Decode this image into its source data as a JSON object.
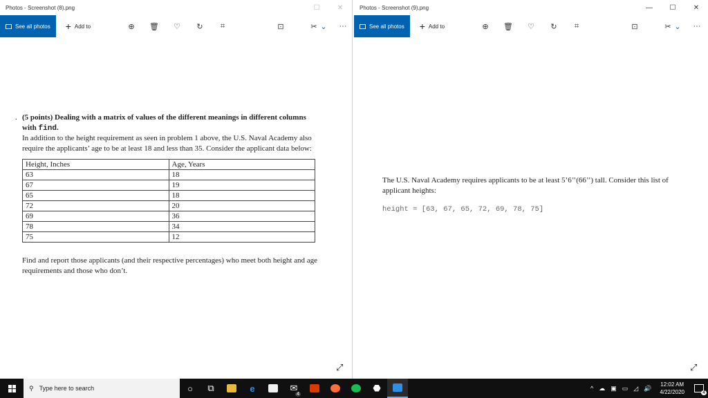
{
  "left_window": {
    "title": "Photos - Screenshot (8).png",
    "see_all": "See all photos",
    "add_to": "Add to",
    "content": {
      "bullet": ".",
      "heading_part1": "(5 points) Dealing with a matrix of values of the different meanings in different columns with ",
      "heading_code": "find",
      "heading_end": ".",
      "paragraph": "In addition to the height requirement as seen in problem 1 above, the U.S. Naval Academy also require the applicants’ age to be at least 18 and less than 35. Consider the applicant data below:",
      "table_headers": [
        "Height, Inches",
        "Age, Years"
      ],
      "table_rows": [
        [
          "63",
          "18"
        ],
        [
          "67",
          "19"
        ],
        [
          "65",
          "18"
        ],
        [
          "72",
          "20"
        ],
        [
          "69",
          "36"
        ],
        [
          "78",
          "34"
        ],
        [
          "75",
          "12"
        ]
      ],
      "find_text": "Find and report those applicants (and their respective percentages) who meet both height and age requirements and those who don’t."
    }
  },
  "right_window": {
    "title": "Photos - Screenshot (9).png",
    "see_all": "See all photos",
    "add_to": "Add to",
    "content": {
      "paragraph": "The U.S. Naval Academy requires applicants to be at least 5’6’’(66’’) tall. Consider this list of applicant heights:",
      "code": "height = [63, 67, 65, 72, 69, 78, 75]"
    }
  },
  "window_controls": {
    "minimize": "—",
    "maximize": "☐",
    "close": "✕"
  },
  "toolbar_glyphs": {
    "zoom": "⊕",
    "delete": "🗑",
    "favorite": "♡",
    "rotate": "↻",
    "crop": "⌗",
    "enhance": "⊡",
    "edit": "✂",
    "chevron": "⌄",
    "more": "···",
    "expand": "⤢"
  },
  "taskbar": {
    "search_placeholder": "Type here to search",
    "time": "12:02 AM",
    "date": "4/22/2020",
    "notification_count": "4",
    "mail_badge": "4"
  }
}
